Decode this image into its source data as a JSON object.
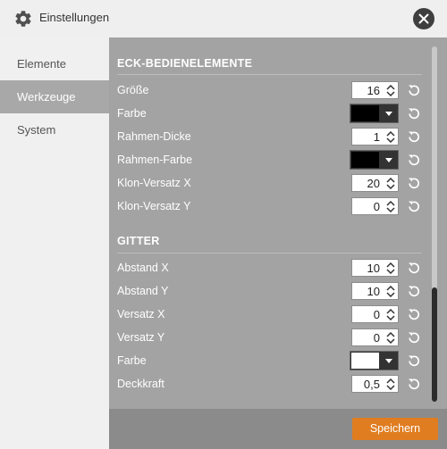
{
  "window": {
    "title": "Einstellungen",
    "icon": "gear-icon",
    "close_icon": "close-icon"
  },
  "sidebar": {
    "items": [
      {
        "label": "Elemente",
        "active": false
      },
      {
        "label": "Werkzeuge",
        "active": true
      },
      {
        "label": "System",
        "active": false
      }
    ]
  },
  "sections": [
    {
      "title": "ECK-BEDIENELEMENTE",
      "rows": [
        {
          "label": "Größe",
          "type": "number",
          "value": "16"
        },
        {
          "label": "Farbe",
          "type": "color",
          "value": "#000000"
        },
        {
          "label": "Rahmen-Dicke",
          "type": "number",
          "value": "1"
        },
        {
          "label": "Rahmen-Farbe",
          "type": "color",
          "value": "#000000"
        },
        {
          "label": "Klon-Versatz X",
          "type": "number",
          "value": "20"
        },
        {
          "label": "Klon-Versatz Y",
          "type": "number",
          "value": "0"
        }
      ]
    },
    {
      "title": "GITTER",
      "rows": [
        {
          "label": "Abstand X",
          "type": "number",
          "value": "10"
        },
        {
          "label": "Abstand Y",
          "type": "number",
          "value": "10"
        },
        {
          "label": "Versatz X",
          "type": "number",
          "value": "0"
        },
        {
          "label": "Versatz Y",
          "type": "number",
          "value": "0"
        },
        {
          "label": "Farbe",
          "type": "color",
          "value": "#ffffff"
        },
        {
          "label": "Deckkraft",
          "type": "number",
          "value": "0,5"
        }
      ]
    }
  ],
  "footer": {
    "save_label": "Speichern"
  },
  "colors": {
    "accent": "#e07d21",
    "content_bg": "#a3a3a3",
    "footer_bg": "#8b8b8b",
    "active_nav": "#a8a8a8"
  }
}
